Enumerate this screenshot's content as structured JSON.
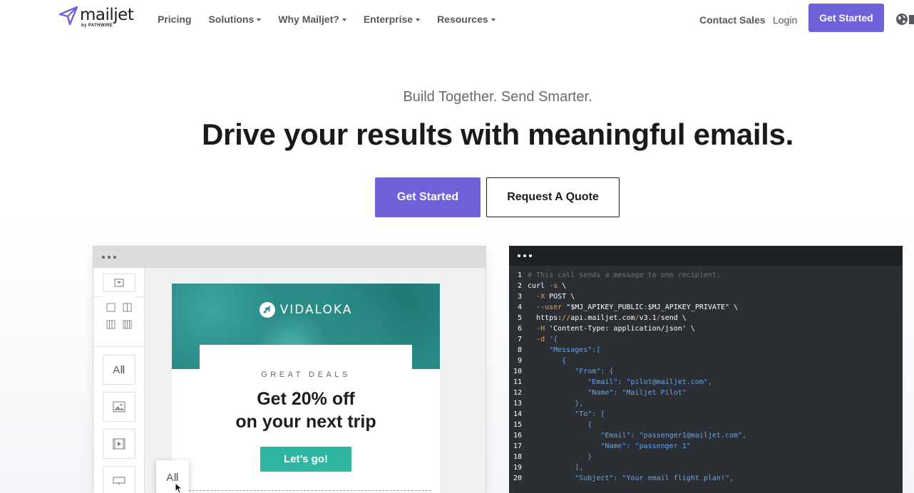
{
  "nav": {
    "logo_word": "mailjet",
    "logo_by": "by PATHWIRE",
    "menu": [
      {
        "label": "Pricing",
        "dropdown": false
      },
      {
        "label": "Solutions",
        "dropdown": true
      },
      {
        "label": "Why Mailjet?",
        "dropdown": true
      },
      {
        "label": "Enterprise",
        "dropdown": true
      },
      {
        "label": "Resources",
        "dropdown": true
      }
    ],
    "contact_sales": "Contact Sales",
    "login": "Login",
    "get_started": "Get Started"
  },
  "hero": {
    "tagline": "Build Together. Send Smarter.",
    "headline": "Drive your results with meaningful emails.",
    "primary_cta": "Get Started",
    "secondary_cta": "Request A Quote"
  },
  "editor_preview": {
    "brand": "VIDALOKA",
    "eyebrow": "GREAT DEALS",
    "offer_line1": "Get 20% off",
    "offer_line2": "on your next trip",
    "button": "Let’s go!",
    "text_tool_label": "A"
  },
  "code_preview": {
    "lines": [
      {
        "n": "1",
        "parts": [
          {
            "t": "# This call sends a message to one recipient.",
            "c": "comment"
          }
        ]
      },
      {
        "n": "2",
        "parts": [
          {
            "t": "curl ",
            "c": "plain"
          },
          {
            "t": "-s",
            "c": "op"
          },
          {
            "t": " \\",
            "c": "plain"
          }
        ]
      },
      {
        "n": "3",
        "parts": [
          {
            "t": "  ",
            "c": "plain"
          },
          {
            "t": "-X",
            "c": "op"
          },
          {
            "t": " POST \\",
            "c": "plain"
          }
        ]
      },
      {
        "n": "4",
        "parts": [
          {
            "t": "  ",
            "c": "plain"
          },
          {
            "t": "--user",
            "c": "op"
          },
          {
            "t": " \"",
            "c": "plain"
          },
          {
            "t": "$MJ_APIKEY_PUBLIC",
            "c": "plain"
          },
          {
            "t": ":",
            "c": "op"
          },
          {
            "t": "$MJ_APIKEY_PRIVATE",
            "c": "plain"
          },
          {
            "t": "\" \\",
            "c": "plain"
          }
        ]
      },
      {
        "n": "5",
        "parts": [
          {
            "t": "  https:",
            "c": "plain"
          },
          {
            "t": "//",
            "c": "op"
          },
          {
            "t": "api.mailjet.com",
            "c": "plain"
          },
          {
            "t": "/",
            "c": "op"
          },
          {
            "t": "v3.1",
            "c": "plain"
          },
          {
            "t": "/",
            "c": "op"
          },
          {
            "t": "send \\",
            "c": "plain"
          }
        ]
      },
      {
        "n": "6",
        "parts": [
          {
            "t": "  ",
            "c": "plain"
          },
          {
            "t": "-H",
            "c": "op"
          },
          {
            "t": " 'Content-Type: application/json' \\",
            "c": "plain"
          }
        ]
      },
      {
        "n": "7",
        "parts": [
          {
            "t": "  ",
            "c": "plain"
          },
          {
            "t": "-d",
            "c": "op"
          },
          {
            "t": " '{",
            "c": "str"
          }
        ]
      },
      {
        "n": "8",
        "parts": [
          {
            "t": "     \"Messages\":[",
            "c": "str"
          }
        ]
      },
      {
        "n": "9",
        "parts": [
          {
            "t": "        {",
            "c": "str"
          }
        ]
      },
      {
        "n": "10",
        "parts": [
          {
            "t": "           \"From\": {",
            "c": "str"
          }
        ]
      },
      {
        "n": "11",
        "parts": [
          {
            "t": "              \"Email\": \"pilot@mailjet.com\",",
            "c": "str"
          }
        ]
      },
      {
        "n": "12",
        "parts": [
          {
            "t": "              \"Name\": \"Mailjet Pilot\"",
            "c": "str"
          }
        ]
      },
      {
        "n": "13",
        "parts": [
          {
            "t": "           },",
            "c": "str"
          }
        ]
      },
      {
        "n": "14",
        "parts": [
          {
            "t": "           \"To\": [",
            "c": "str"
          }
        ]
      },
      {
        "n": "15",
        "parts": [
          {
            "t": "              {",
            "c": "str"
          }
        ]
      },
      {
        "n": "16",
        "parts": [
          {
            "t": "                 \"Email\": \"passenger1@mailjet.com\",",
            "c": "str"
          }
        ]
      },
      {
        "n": "17",
        "parts": [
          {
            "t": "                 \"Name\": \"passenger 1\"",
            "c": "str"
          }
        ]
      },
      {
        "n": "18",
        "parts": [
          {
            "t": "              }",
            "c": "str"
          }
        ]
      },
      {
        "n": "19",
        "parts": [
          {
            "t": "           ],",
            "c": "str"
          }
        ]
      },
      {
        "n": "20",
        "parts": [
          {
            "t": "           \"Subject\": \"Your email flight plan!\",",
            "c": "str"
          }
        ]
      }
    ]
  },
  "colors": {
    "brand_purple": "#6e61d9",
    "email_button": "#2eb6a0",
    "code_bg": "#2b2f33",
    "code_string": "#5aa5ff",
    "code_operator": "#e6a15a"
  },
  "icons": [
    "mailjet-paper-plane-logo",
    "globe-icon",
    "caret-down-icon",
    "plane-icon",
    "cursor-icon"
  ]
}
